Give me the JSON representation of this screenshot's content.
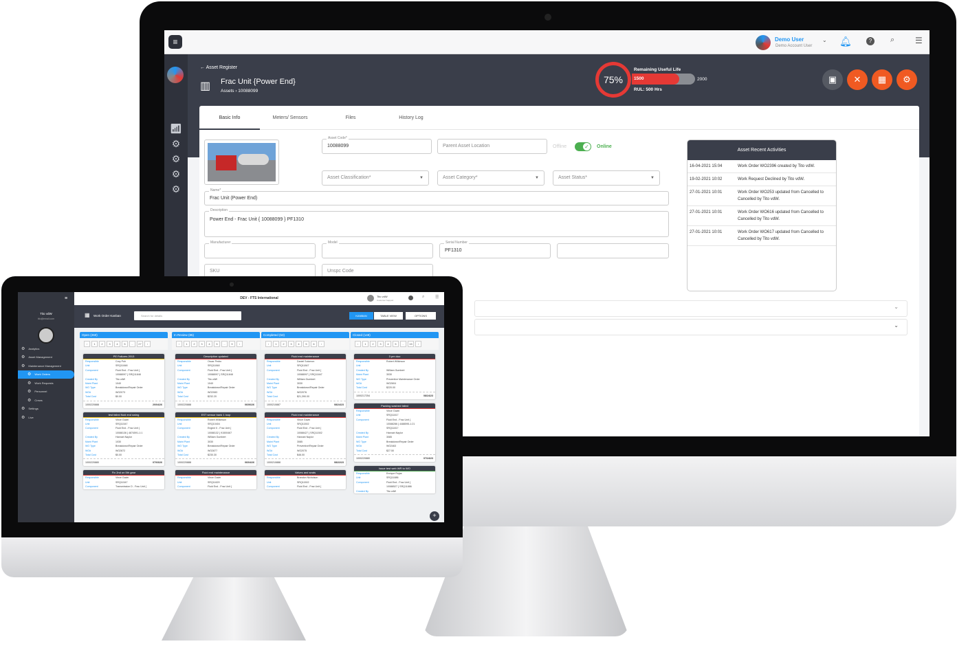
{
  "desktop": {
    "topbar": {
      "user_name": "Demo User",
      "user_role": "Demo Account User"
    },
    "breadcrumb_back": "Asset Register",
    "asset_title": "Frac Unit {Power End}",
    "asset_crumb": "Assets",
    "asset_crumb_id": "10088099",
    "rul": {
      "percent": "75%",
      "label": "Remaining Useful Life",
      "current": "1500",
      "max": "2000",
      "fill_fraction": 0.75,
      "rul_text": "RUL: 500 Hrs"
    },
    "tabs": [
      "Basic Info",
      "Meters/ Sensors",
      "Files",
      "History Log"
    ],
    "form": {
      "asset_code_label": "Asset Code*",
      "asset_code": "10088099",
      "parent_location": "Parent Asset Location",
      "offline": "Offline",
      "online": "Online",
      "classification": "Asset Classification*",
      "category": "Asset Category*",
      "status": "Asset Status*",
      "name_label": "Name*",
      "name": "Frac Unit (Power End)",
      "description_label": "Description",
      "description": "Power End - Frac Unit { 10088099 } PF1310",
      "manufacturer_label": "Manufacturer",
      "model_label": "Model",
      "serial_label": "Serial Number",
      "serial": "PF1310",
      "sku": "SKU",
      "unspc": "Unspc Code"
    },
    "activities": {
      "title": "Asset Recent Activities",
      "items": [
        {
          "date": "16-04-2021 15:04",
          "text": "Work Order WO2396 created by Tito vdW."
        },
        {
          "date": "19-02-2021 10:02",
          "text": "Work Request Declined by Tito vdW."
        },
        {
          "date": "27-01-2021 10:01",
          "text": "Work Order WO253 updated from Cancelled to Cancelled by Tito vdW."
        },
        {
          "date": "27-01-2021 10:01",
          "text": "Work Order WO616 updated from Cancelled to Cancelled by Tito vdW."
        },
        {
          "date": "27-01-2021 10:01",
          "text": "Work Order WO617 updated from Cancelled to Cancelled by Tito vdW."
        }
      ]
    },
    "colors": {
      "accent": "#f05a22",
      "header": "#3a3e4a",
      "rul_red": "#e53935",
      "online": "#4caf50"
    }
  },
  "laptop": {
    "org_title": "DEV - FTS International",
    "user_name": "Tito vdW",
    "user_role": "Customer Support",
    "user_email": "tito@email.com",
    "page_title": "Work Order Kanban",
    "search_placeholder": "Search for details",
    "kanban_btn": "KANBAN",
    "table_btn": "TABLE VIEW",
    "options_btn": "OPTIONS",
    "nav": [
      {
        "label": "Analytics",
        "icon": "chart-icon",
        "cls": ""
      },
      {
        "label": "Asset Management",
        "icon": "gears-icon",
        "cls": ""
      },
      {
        "label": "Maintenance Management",
        "icon": "wrench-icon",
        "cls": ""
      },
      {
        "label": "Work Orders",
        "icon": "calendar-icon",
        "cls": "sub act2"
      },
      {
        "label": "Work Requests",
        "icon": "request-icon",
        "cls": "sub"
      },
      {
        "label": "Personnel",
        "icon": "people-icon",
        "cls": "sub"
      },
      {
        "label": "Crews",
        "icon": "crew-icon",
        "cls": "sub"
      },
      {
        "label": "Settings",
        "icon": "gear-icon",
        "cls": ""
      },
      {
        "label": "Live",
        "icon": "live-icon",
        "cls": ""
      }
    ],
    "columns": [
      {
        "title": "Open (260)",
        "pages": [
          "‹",
          "1",
          "2",
          "3",
          "4",
          "5",
          "..",
          "27",
          "›"
        ],
        "cards": [
          {
            "title": "PE Failures 2013",
            "c": "y",
            "rows": [
              [
                "Responsible",
                "Cory Poh"
              ],
              [
                "Unit",
                "SRQ11848"
              ],
              [
                "Component",
                "Fluid End - Frac Unit {"
              ],
              [
                "",
                "10088097 } SRQ11848"
              ],
              [
                "Created By",
                "Tito vdW"
              ],
              [
                "Maint Plant",
                "1040"
              ],
              [
                "WO Type",
                "Breakdown/Repair Order"
              ],
              [
                "WO#",
                "WO2073"
              ],
              [
                "Total Cost",
                "$0.00"
              ]
            ],
            "id": "1000220888",
            "date": "20/04/26"
          },
          {
            "title": "test failed fluid end swing",
            "c": "y",
            "rows": [
              [
                "Responsible",
                "Vince Gavin"
              ],
              [
                "Unit",
                "SRQ11547"
              ],
              [
                "Component",
                "Fluid End - Frac Unit {"
              ],
              [
                "",
                "10088136 } 4874591-1:1"
              ],
              [
                "Created By",
                "Hannah Naylor"
              ],
              [
                "Maint Plant",
                "1030"
              ],
              [
                "WO Type",
                "Breakdown/Repair Order"
              ],
              [
                "WO#",
                "WO2872"
              ],
              [
                "Total Cost",
                "$0.00"
              ]
            ],
            "id": "1000220880",
            "date": "07/03/26"
          },
          {
            "title": "Fix 2nd on 5th gear",
            "c": "",
            "rows": [
              [
                "Responsible",
                "Vince Gavin"
              ],
              [
                "Unit",
                "SRQ11547"
              ],
              [
                "Component",
                "Transmission D - Frac Unit {"
              ]
            ],
            "id": "",
            "date": ""
          }
        ]
      },
      {
        "title": "In Review (85)",
        "pages": [
          "‹",
          "1",
          "2",
          "3",
          "4",
          "5",
          "..",
          "9",
          "›"
        ],
        "cards": [
          {
            "title": "Description updated",
            "c": "",
            "rows": [
              [
                "Responsible",
                "Oscar Pedro"
              ],
              [
                "Unit",
                "SRQ11848"
              ],
              [
                "Component",
                "Fluid End - Frac Unit {"
              ],
              [
                "",
                "10088097 } SRQ11848"
              ],
              [
                "Created By",
                "Tito vdW"
              ],
              [
                "Maint Plant",
                "1040"
              ],
              [
                "WO Type",
                "Breakdown/Repair Order"
              ],
              [
                "WO#",
                "WO2083"
              ],
              [
                "Total Cost",
                "$232.20"
              ]
            ],
            "id": "1000220888",
            "date": "06/06/26"
          },
          {
            "title": "EST sensor bank 1 loop",
            "c": "y",
            "rows": [
              [
                "Responsible",
                "Robert Wilkinson"
              ],
              [
                "Unit",
                "SRQ10404"
              ],
              [
                "Component",
                "Engine II - Frac Unit {"
              ],
              [
                "",
                "10088132 } 91500467"
              ],
              [
                "Created By",
                "William Gumbert"
              ],
              [
                "Maint Plant",
                "3030"
              ],
              [
                "WO Type",
                "Breakdown/Repair Order"
              ],
              [
                "WO#",
                "WO2877"
              ],
              [
                "Total Cost",
                "$230.30"
              ]
            ],
            "id": "1000220888",
            "date": "06/04/26"
          },
          {
            "title": "Fluid end maintenance",
            "c": "",
            "rows": [
              [
                "Responsible",
                "Vince Gavin"
              ],
              [
                "Unit",
                "SRQ11629"
              ],
              [
                "Component",
                "Fluid End - Frac Unit {"
              ]
            ],
            "id": "",
            "date": ""
          }
        ]
      },
      {
        "title": "Completed (53)",
        "pages": [
          "‹",
          "1",
          "2",
          "3",
          "4",
          "5",
          "6",
          "›"
        ],
        "cards": [
          {
            "title": "Fluid end maintenance",
            "c": "",
            "rows": [
              [
                "Responsible",
                "Daniel Solomon"
              ],
              [
                "Unit",
                "SRQ11847"
              ],
              [
                "Component",
                "Fluid End - Frac Unit {"
              ],
              [
                "",
                "10088097 } SRQ11847"
              ],
              [
                "Created By",
                "William Gumbert"
              ],
              [
                "Maint Plant",
                "3030"
              ],
              [
                "WO Type",
                "Breakdown/Repair Order"
              ],
              [
                "WO#",
                "WO2076"
              ],
              [
                "Total Cost",
                "$21,390.00"
              ]
            ],
            "id": "1000210887",
            "date": "08/24/23"
          },
          {
            "title": "Fluid end maintenance",
            "c": "",
            "rows": [
              [
                "Responsible",
                "Vince Gavin"
              ],
              [
                "Unit",
                "SRQ11502"
              ],
              [
                "Component",
                "Fluid End - Frac Unit {"
              ],
              [
                "",
                "10088427 } SRQ11502"
              ],
              [
                "Created By",
                "Hannah Naylor"
              ],
              [
                "Maint Plant",
                "3085"
              ],
              [
                "WO Type",
                "Preventive/Repair Order"
              ],
              [
                "WO#",
                "WO2075"
              ],
              [
                "Total Cost",
                "$46.00"
              ]
            ],
            "id": "1000210888",
            "date": "08/22/23"
          },
          {
            "title": "Valves and seats",
            "c": "",
            "rows": [
              [
                "Responsible",
                "Brandon Nicholson"
              ],
              [
                "Unit",
                "SRQ11502"
              ],
              [
                "Component",
                "Fluid End - Frac Unit {"
              ]
            ],
            "id": "",
            "date": ""
          }
        ]
      },
      {
        "title": "Closed (148)",
        "pages": [
          "‹",
          "1",
          "2",
          "3",
          "4",
          "5",
          "..",
          "15",
          "›"
        ],
        "cards": [
          {
            "title": "3 pm duo",
            "c": "",
            "rows": [
              [
                "Responsible",
                "Robert Wilkinson"
              ],
              [
                "Unit",
                ""
              ],
              [
                "Created By",
                "William Gumbert"
              ],
              [
                "Maint Plant",
                "3030"
              ],
              [
                "WO Type",
                "Preventive Maintenance Order"
              ],
              [
                "WO#",
                "WO2604"
              ],
              [
                "Total Cost",
                "$220.00"
              ]
            ],
            "id": "1000217254",
            "date": "08/24/23"
          },
          {
            "title": "Packing washed failed",
            "c": "",
            "rows": [
              [
                "Responsible",
                "Vince Gavin"
              ],
              [
                "Unit",
                "SRQ11817"
              ],
              [
                "Component",
                "Fluid End - Frac Unit {"
              ],
              [
                "",
                "10088286 } 4488595-1:21"
              ],
              [
                "",
                "SRQ11817"
              ],
              [
                "Created By",
                "Hannah Naylor"
              ],
              [
                "Maint Plant",
                "3085"
              ],
              [
                "WO Type",
                "Breakdown/Repair Order"
              ],
              [
                "WO#",
                "WO2463"
              ],
              [
                "Total Cost",
                "$27.50"
              ]
            ],
            "id": "1000220880",
            "date": "07/24/23"
          },
          {
            "title": "Issue test web WR to WO",
            "c": "g",
            "rows": [
              [
                "Responsible",
                "Enrique Rojas"
              ],
              [
                "Unit",
                "SRQ11886"
              ],
              [
                "Component",
                "Fluid End - Frac Unit {"
              ],
              [
                "",
                "10088527 } SRQ11886"
              ],
              [
                "Created By",
                "Tito vdW"
              ]
            ],
            "id": "",
            "date": ""
          }
        ]
      }
    ]
  }
}
